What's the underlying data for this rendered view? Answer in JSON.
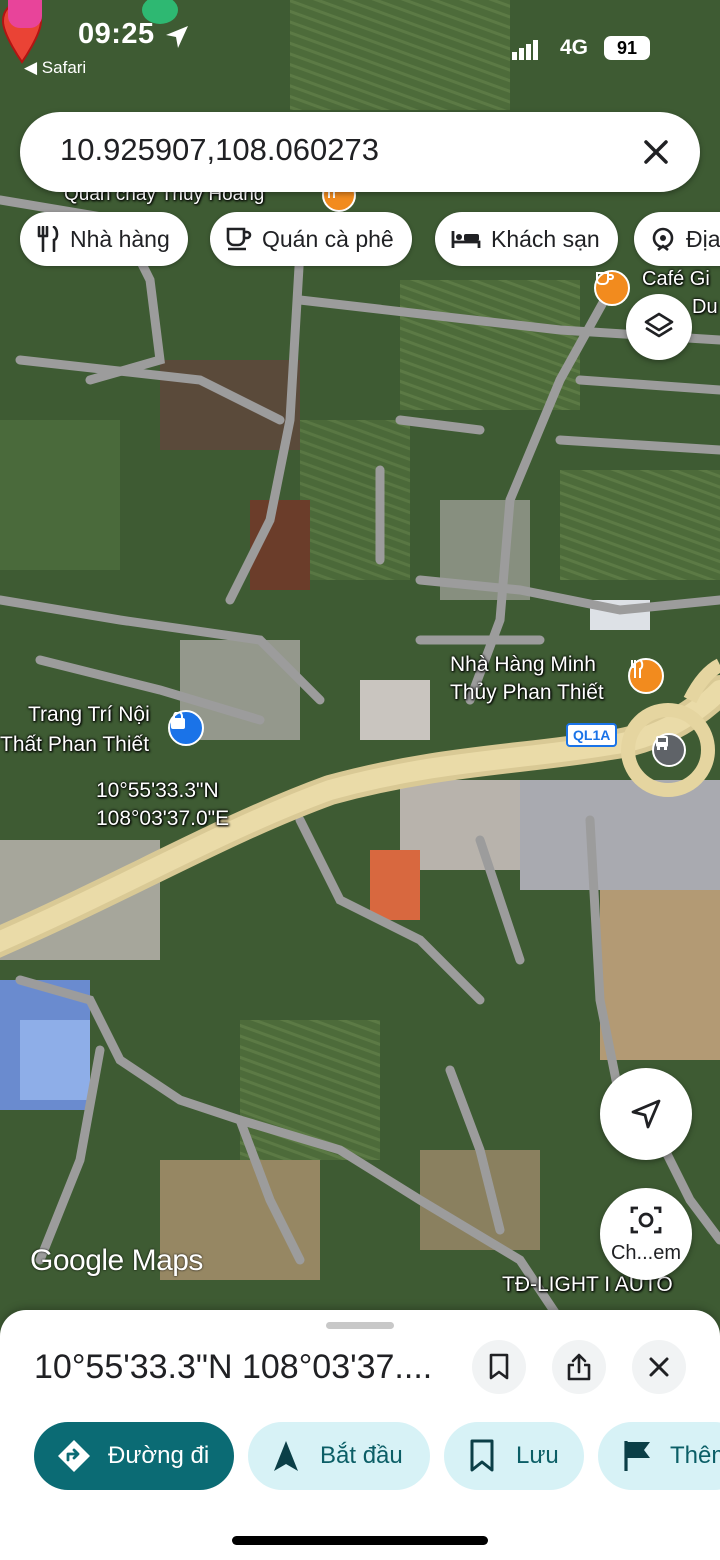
{
  "status_bar": {
    "time": "09:25",
    "back_app": "◀ Safari",
    "network": "4G",
    "battery": "91"
  },
  "search": {
    "query": "10.925907,108.060273"
  },
  "chips": [
    {
      "label": "Nhà hàng",
      "icon": "restaurant-icon"
    },
    {
      "label": "Quán cà phê",
      "icon": "coffee-icon"
    },
    {
      "label": "Khách sạn",
      "icon": "hotel-icon"
    },
    {
      "label": "Địa",
      "icon": "attraction-icon"
    }
  ],
  "map": {
    "labels": {
      "poi_top": "Quán chay Thủy Hoàng",
      "cafe_line1": "Café Gi",
      "cafe_line2": "Du",
      "restaurant_line1": "Nhà Hàng Minh",
      "restaurant_line2": "Thủy Phan Thiết",
      "decor_line1": "Trang Trí Nội",
      "decor_line2": "Thất Phan Thiết",
      "pin_lat": "10°55'33.3\"N",
      "pin_lng": "108°03'37.0\"E",
      "light_auto": "TĐ-LIGHT I AUTO",
      "road_shield": "QL1A"
    },
    "logo": "Google Maps"
  },
  "fabs": {
    "camera_label": "Ch...em"
  },
  "sheet": {
    "title": "10°55'33.3\"N 108°03'37....",
    "actions": [
      {
        "label": "Đường đi",
        "icon": "directions-icon",
        "style": "primary"
      },
      {
        "label": "Bắt đầu",
        "icon": "navigation-icon",
        "style": "secondary"
      },
      {
        "label": "Lưu",
        "icon": "bookmark-icon",
        "style": "secondary"
      },
      {
        "label": "Thêm",
        "icon": "flag-icon",
        "style": "secondary"
      }
    ]
  },
  "colors": {
    "primary_button": "#0b6b74",
    "secondary_button": "#d7f2f6",
    "road": "#e3d4a0",
    "pin": "#ea4335"
  }
}
